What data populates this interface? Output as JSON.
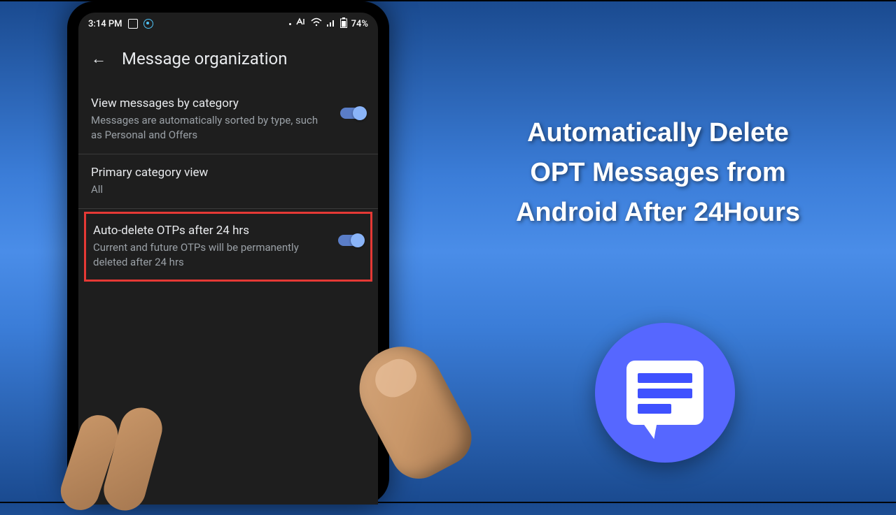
{
  "promo": {
    "line1": "Automatically Delete",
    "line2": "OPT Messages from",
    "line3": "Android After 24Hours"
  },
  "status_bar": {
    "time": "3:14 PM",
    "battery_percent": "74%"
  },
  "screen": {
    "title": "Message organization"
  },
  "settings": {
    "category": {
      "title": "View messages by category",
      "desc": "Messages are automatically sorted by type, such as Personal and Offers",
      "toggled": true
    },
    "primary_view": {
      "title": "Primary category view",
      "value": "All"
    },
    "auto_delete": {
      "title": "Auto-delete OTPs after 24 hrs",
      "desc": "Current and future OTPs will be permanently deleted after 24 hrs",
      "toggled": true
    }
  }
}
